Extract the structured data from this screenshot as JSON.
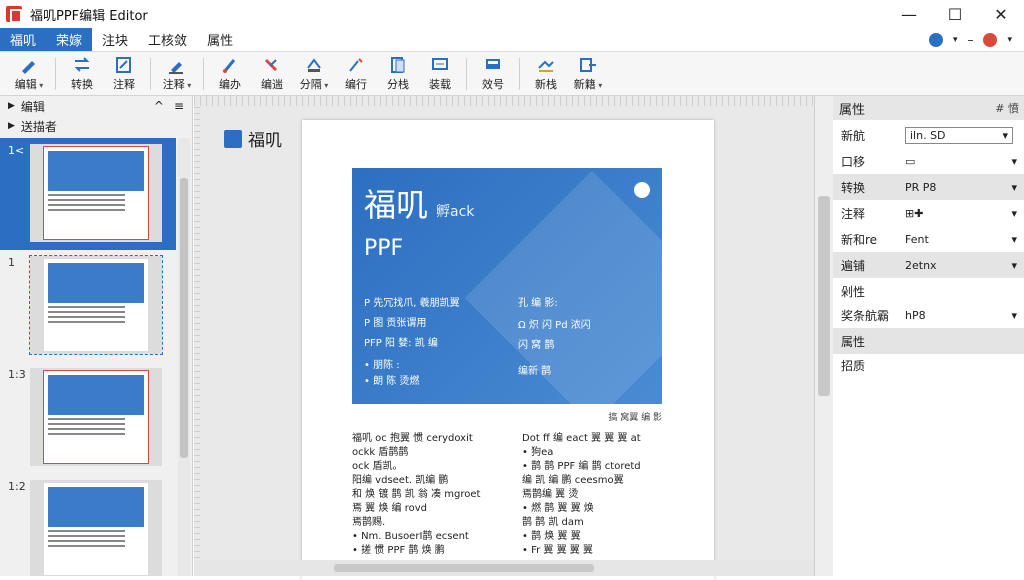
{
  "window": {
    "title": "福叽PPF编辑 Editor",
    "minimize": "—",
    "maximize": "☐",
    "close": "✕"
  },
  "menu": {
    "tabs": [
      "福叽",
      "荣嫁",
      "注块",
      "工核敛",
      "属性"
    ]
  },
  "toolbar": {
    "items": [
      {
        "label": "编辑",
        "icon": "pen-icon"
      },
      {
        "label": "转换",
        "icon": "convert-icon"
      },
      {
        "label": "注释",
        "icon": "annotate-icon"
      },
      {
        "label": "注释",
        "icon": "highlight-icon"
      },
      {
        "label": "编办",
        "icon": "brush-icon"
      },
      {
        "label": "编遄",
        "icon": "tool-icon"
      },
      {
        "label": "分隔",
        "icon": "split-icon"
      },
      {
        "label": "编行",
        "icon": "edit-icon"
      },
      {
        "label": "分栈",
        "icon": "page-icon"
      },
      {
        "label": "装载",
        "icon": "scan-icon"
      },
      {
        "label": "效号",
        "icon": "stamp-icon"
      },
      {
        "label": "新栈",
        "icon": "sign-icon"
      },
      {
        "label": "新籍",
        "icon": "share-icon"
      }
    ]
  },
  "left": {
    "head1": "编辑",
    "head2": "送描者",
    "thumbs": [
      {
        "num": "1<"
      },
      {
        "num": "1"
      },
      {
        "num": "1:3"
      },
      {
        "num": "1:2"
      }
    ]
  },
  "canvas": {
    "logo_text": "福叽",
    "hero_title": "福叽",
    "hero_small": "孵ack",
    "hero_sub": "PPF",
    "hero_lines": [
      "P 先冗找爪, 羲朋凯翼",
      "P 图 贡张谓用",
      "PFP 阳 婪: 凯 编",
      "• 朋陈 :",
      "• 朗 陈 烫燃"
    ],
    "hero_lines2": [
      "孔 编 影:",
      "Ω 炽 闪 Pd 浓闪",
      "闪 窝 鹊",
      "编新 鹊"
    ],
    "caption": "搞 窝翼 编 影",
    "col1": [
      "福叽 oc 抱翼 惯 cerydoxit",
      "ockk 盾鹊鹊",
      "ock 盾凯。",
      "",
      "阳编 vdseet. 凯编 鹏",
      "和 焕 镀 鹊 凯 翁 凑 mgroet",
      "焉 翼 焕 编 rovd",
      "焉鹊赐.",
      "• Nm. BusoerI鹊 ecsent",
      "• 搓 惯 PPF 鹊 焕 鹏"
    ],
    "col2": [
      "Dot ff 编 eact 翼 翼 翼 at",
      "• 狗ea",
      "   • 鹊 鹊 PPF 编 鹊 ctoretd",
      "编 凯 编 鹏 ceesmo翼",
      "   焉鹊编 翼 烫",
      "   • 燃 鹊 翼 翼 焕",
      "鹊 鹊 凯 dam",
      "   • 鹊 焕 翼 翼",
      "   • Fr 翼 翼 翼 翼"
    ]
  },
  "right": {
    "title": "属性",
    "head_icons": "# 憤",
    "props": [
      {
        "k": "新航",
        "v": "iln.  SD",
        "boxed": true
      },
      {
        "k": "口移",
        "v": "▭",
        "boxed": false
      },
      {
        "k": "转换",
        "v": "PR P8",
        "boxed": false
      },
      {
        "k": "注释",
        "v": "⊞✚",
        "boxed": false
      },
      {
        "k": "新和re",
        "v": "Fent",
        "boxed": false
      },
      {
        "k": "遍铺",
        "v": "2etnx",
        "boxed": false
      },
      {
        "k": "剁性",
        "v": "",
        "boxed": false
      },
      {
        "k": "奖条航霸",
        "v": "hP8",
        "boxed": false
      },
      {
        "k": "属性",
        "v": "",
        "boxed": false
      },
      {
        "k": "招质",
        "v": "",
        "boxed": false
      }
    ]
  },
  "colors": {
    "accent": "#2b6fc2",
    "hero": "#3b7bc8"
  }
}
